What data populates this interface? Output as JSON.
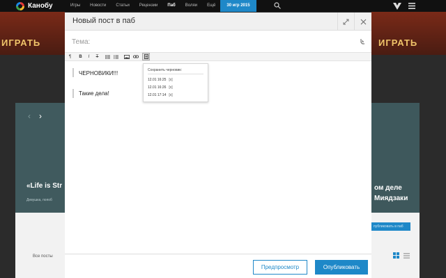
{
  "topbar": {
    "logo": "Канобу",
    "nav": [
      {
        "label": "Игры",
        "active": false
      },
      {
        "label": "Новости",
        "active": false
      },
      {
        "label": "Статьи",
        "active": false
      },
      {
        "label": "Рецензии",
        "active": false
      },
      {
        "label": "Паб",
        "active": true
      },
      {
        "label": "Воляи",
        "active": false
      },
      {
        "label": "Ещё",
        "active": false
      }
    ],
    "promo": "30 игр 2015",
    "icons": {
      "search": "search-icon",
      "brand": "brand-icon",
      "menu": "menu-icon"
    }
  },
  "background": {
    "banner_left": "ИГРАТЬ",
    "banner_right": "ИГРАТЬ",
    "left_title": "«Life is Str",
    "left_subtitle": "Девушка, попоб",
    "right_title_1": "ом деле",
    "right_title_2": "Миядзаки",
    "all_posts": "Все посты",
    "publish_link": "публиковать в паб"
  },
  "modal": {
    "title": "Новый пост в паб",
    "subject_placeholder": "Тема:",
    "toolbar": [
      "paragraph-icon",
      "bold-icon",
      "italic-icon",
      "strikethrough-icon",
      "bullet-list-icon",
      "numbered-list-icon",
      "image-icon",
      "link-icon",
      "drafts-icon"
    ],
    "toolbar_labels": {
      "paragraph": "¶",
      "bold": "B",
      "italic": "I",
      "strike": "T"
    },
    "content": [
      "ЧЕРНОВИКИ!!!",
      "Такие дела!"
    ],
    "drafts": {
      "title": "Сохранить черновик:",
      "items": [
        {
          "time": "12.01 16:25",
          "delete": "[x]"
        },
        {
          "time": "12.01 16:26",
          "delete": "[x]"
        },
        {
          "time": "12.01 17:14",
          "delete": "[x]"
        }
      ]
    },
    "preview_label": "Предпросмотр",
    "publish_label": "Опубликовать"
  },
  "colors": {
    "accent": "#1e88c8",
    "topbar": "#111111",
    "modal_header": "#f0f0f0"
  }
}
